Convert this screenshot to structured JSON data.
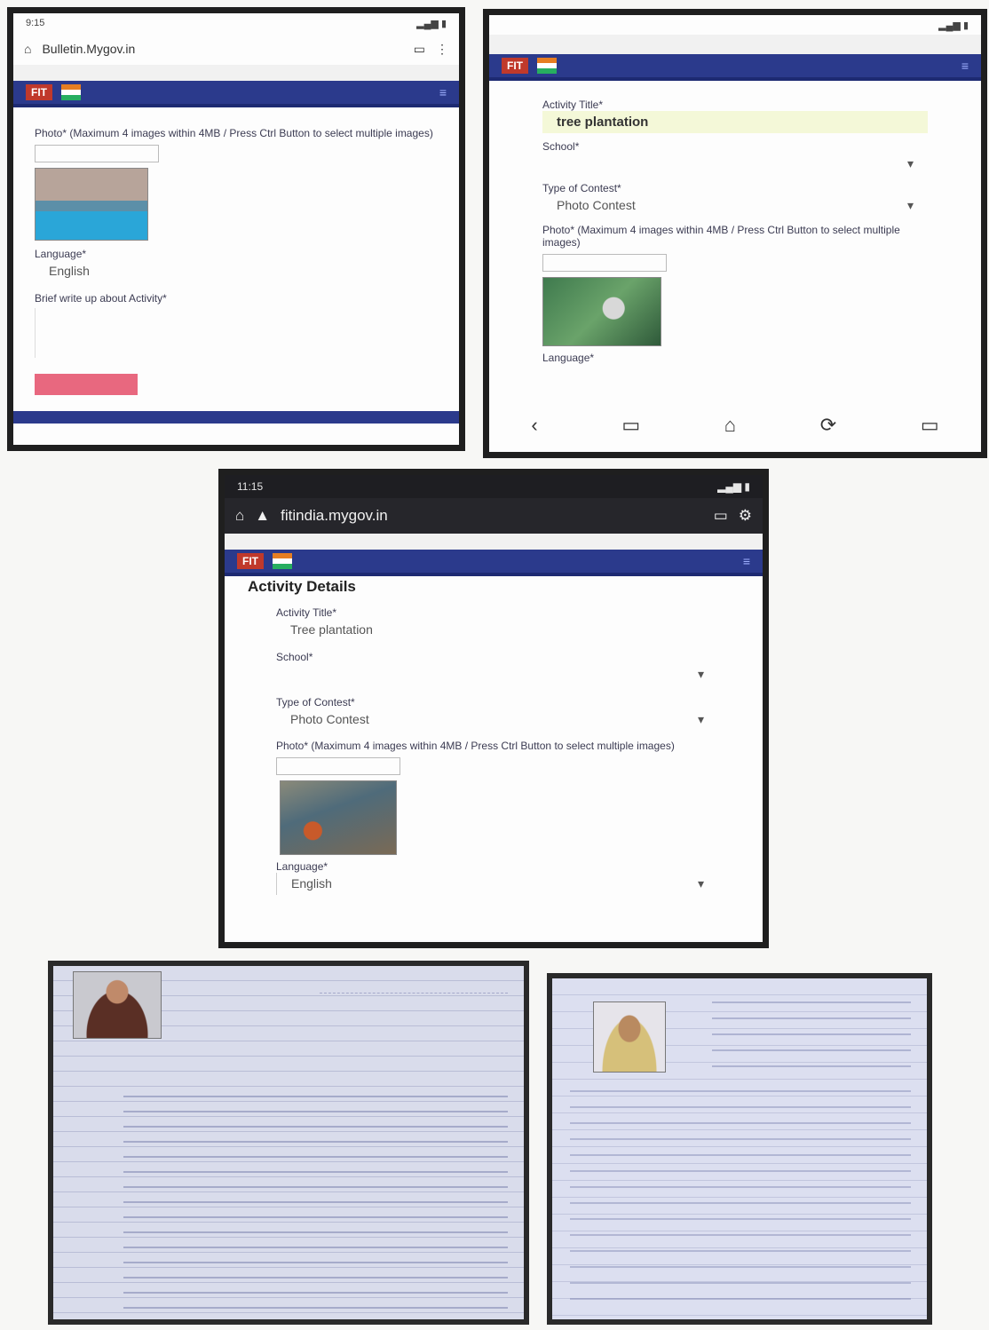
{
  "screen1": {
    "status_time": "9:15",
    "url": "Bulletin.Mygov.in",
    "photos_label": "Photo* (Maximum 4 images within 4MB / Press Ctrl Button to select multiple images)",
    "language_label": "Language*",
    "language_value": "English",
    "brief_label": "Brief write up about Activity*"
  },
  "screen2": {
    "activity_title_label": "Activity Title*",
    "activity_title_value": "tree plantation",
    "school_label": "School*",
    "type_label": "Type of Contest*",
    "type_value": "Photo Contest",
    "photos_label": "Photo* (Maximum 4 images within 4MB / Press Ctrl Button to select multiple images)",
    "language_label": "Language*"
  },
  "screen3": {
    "status_time": "11:15",
    "url": "fitindia.mygov.in",
    "section_title": "Activity Details",
    "activity_title_label": "Activity Title*",
    "activity_title_value": "Tree plantation",
    "school_label": "School*",
    "type_label": "Type of Contest*",
    "type_value": "Photo Contest",
    "photos_label": "Photo* (Maximum 4 images within 4MB / Press Ctrl Button to select multiple images)",
    "language_label": "Language*",
    "language_value": "English"
  },
  "icons": {
    "home": "⌂",
    "lock": "🔒",
    "tabs": "▭",
    "menu": "⋮",
    "dropdown": "▾",
    "back": "‹",
    "hamburger": "≡"
  }
}
